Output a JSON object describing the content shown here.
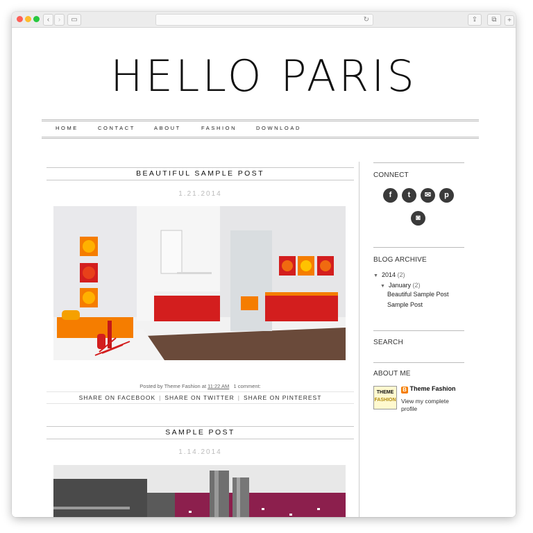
{
  "blog": {
    "title": "HELLO PARIS",
    "nav": [
      "HOME",
      "CONTACT",
      "ABOUT",
      "FASHION",
      "DOWNLOAD"
    ]
  },
  "posts": [
    {
      "title": "BEAUTIFUL SAMPLE POST",
      "date": "1.21.2014",
      "posted_by_label": "Posted by",
      "author": "Theme Fashion",
      "at_label": "at",
      "time": "11:22 AM",
      "comments": "1 comment:",
      "share_facebook": "SHARE ON FACEBOOK",
      "share_twitter": "SHARE ON TWITTER",
      "share_pinterest": "SHARE ON PINTEREST",
      "share_separator": "|"
    },
    {
      "title": "SAMPLE POST",
      "date": "1.14.2014"
    }
  ],
  "sidebar": {
    "connect_title": "CONNECT",
    "social_icons": [
      "facebook-icon",
      "twitter-icon",
      "email-icon",
      "pinterest-icon",
      "instagram-icon"
    ],
    "archive_title": "BLOG ARCHIVE",
    "archive_year": "2014",
    "archive_year_count": "(2)",
    "archive_month": "January",
    "archive_month_count": "(2)",
    "archive_posts": [
      "Beautiful Sample Post",
      "Sample Post"
    ],
    "search_title": "SEARCH",
    "about_title": "ABOUT ME",
    "avatar_text_1": "THEME",
    "avatar_text_2": "FASHION",
    "profile_name": "Theme Fashion",
    "profile_link": "View my complete profile"
  },
  "colors": {
    "accent_orange": "#f57d00",
    "room_red": "#d31e1e",
    "kitchen_magenta": "#8c1f4d",
    "traffic_red": "#fd5f57",
    "traffic_yellow": "#fdbc2e",
    "traffic_green": "#28c840"
  }
}
